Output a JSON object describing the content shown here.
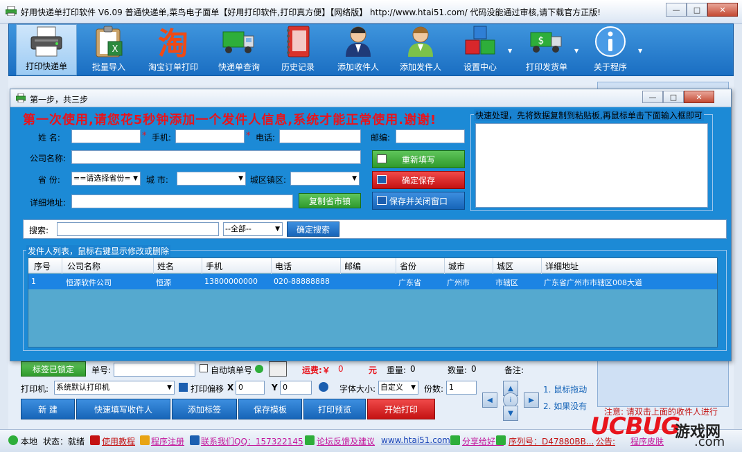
{
  "window": {
    "title": "好用快递单打印软件 V6.09 普通快递单,菜鸟电子面单【好用打印软件,打印真方便】【网络版】    http://www.htai51.com/  代码没能通过审核,请下载官方正版!",
    "controls": {
      "minimize": "—",
      "maximize": "□",
      "close": "✕"
    }
  },
  "toolbar": {
    "items": [
      {
        "label": "打印快递单",
        "icon": "printer-icon"
      },
      {
        "label": "批量导入",
        "icon": "clipboard-excel-icon"
      },
      {
        "label": "淘宝订单打印",
        "icon": "taobao-icon",
        "glyph": "淘"
      },
      {
        "label": "快递单查询",
        "icon": "truck-icon"
      },
      {
        "label": "历史记录",
        "icon": "notebook-icon"
      },
      {
        "label": "添加收件人",
        "icon": "receiver-person-icon"
      },
      {
        "label": "添加发件人",
        "icon": "sender-person-icon"
      },
      {
        "label": "设置中心",
        "icon": "cubes-icon"
      },
      {
        "label": "打印发货单",
        "icon": "money-truck-icon"
      },
      {
        "label": "关于程序",
        "icon": "info-icon"
      }
    ]
  },
  "dialog": {
    "title": "第一步，共三步",
    "notice": "第一次使用,请您花5秒钟添加一个发件人信息,系统才能正常使用.谢谢!",
    "form": {
      "name_label": "姓  名:",
      "mobile_label": "手机:",
      "phone_label": "电话:",
      "zip_label": "邮编:",
      "company_label": "公司名称:",
      "province_label": "省  份:",
      "province_value": "==请选择省份=",
      "city_label": "城  市:",
      "district_label": "城区镇区:",
      "address_label": "详细地址:",
      "copy_button": "复制省市镇",
      "required_mark": "*"
    },
    "buttons": {
      "refill": "重新填写",
      "save": "确定保存",
      "save_close": "保存并关闭窗口"
    },
    "quick": {
      "legend": "快速处理，先将数据复制到粘贴板,再鼠标单击下面输入框即可"
    },
    "search": {
      "label": "搜索:",
      "filter_value": "--全部--",
      "button": "确定搜索"
    },
    "list": {
      "legend": "发件人列表，鼠标右键显示修改或删除",
      "columns": [
        "序号",
        "公司名称",
        "姓名",
        "手机",
        "电话",
        "邮编",
        "省份",
        "城市",
        "城区",
        "详细地址"
      ],
      "rows": [
        [
          "1",
          "恒源软件公司",
          "恒源",
          "13800000000",
          "020-88888888",
          "",
          "广东省",
          "广州市",
          "市辖区",
          "广东省广州市市辖区008大道"
        ]
      ]
    }
  },
  "bottom": {
    "label_locked": "标签已锁定",
    "order_no_label": "单号:",
    "auto_fill_label": "自动填单号",
    "freight_label": "运费:￥",
    "freight_value": "0",
    "freight_unit": "元",
    "weight_label": "重量:",
    "weight_value": "0",
    "quantity_label": "数量:",
    "quantity_value": "0",
    "remark_label": "备注:",
    "printer_label": "打印机:",
    "printer_value": "系统默认打印机",
    "offset_label": "打印偏移",
    "offset_x_label": "X",
    "offset_x_value": "0",
    "offset_y_label": "Y",
    "offset_y_value": "0",
    "font_size_label": "字体大小:",
    "font_size_value": "自定义",
    "copies_label": "份数:",
    "copies_value": "1",
    "actions": [
      "新  建",
      "快速填写收件人",
      "添加标签",
      "保存模板",
      "打印预览",
      "开始打印"
    ],
    "hints": [
      "1. 鼠标拖动",
      "2. 如果没有"
    ],
    "notice": "注意: 请双击上面的收件人进行"
  },
  "statusbar": {
    "local": "本地",
    "state": "状态：就绪",
    "tutorial": "使用教程",
    "register": "程序注册",
    "qq": "联系我们QQ：157322145",
    "forum": "论坛反馈及建议",
    "site": "www.htai51.com",
    "share": "分享给好友",
    "serial": "序列号：D47880BB...",
    "announce": "公告:",
    "skin": "程序皮肤"
  },
  "watermark": {
    "brand": "UCBUG",
    "suffix": "游戏网",
    "domain": ".com"
  }
}
